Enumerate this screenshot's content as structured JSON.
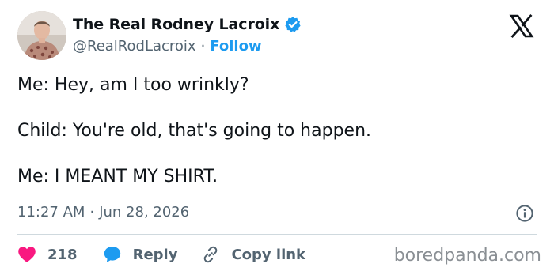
{
  "author": {
    "display_name": "The Real Rodney Lacroix",
    "handle": "@RealRodLacroix",
    "separator": "·",
    "follow_label": "Follow",
    "verified_badge_icon": "verified-badge-icon",
    "avatar_icon": "avatar-photo"
  },
  "brand_icon": "x-logo-icon",
  "tweet": {
    "lines": [
      "Me: Hey, am I too wrinkly?",
      "Child: You're old, that's going to happen.",
      "Me: I MEANT MY SHIRT."
    ]
  },
  "meta": {
    "time": "11:27 AM",
    "separator": "·",
    "date": "Jun 28, 2026",
    "info_icon": "info-icon"
  },
  "actions": {
    "like_count": "218",
    "like_icon": "heart-icon",
    "reply_label": "Reply",
    "reply_icon": "speech-bubble-icon",
    "copy_label": "Copy link",
    "copy_icon": "link-icon"
  },
  "watermark": "boredpanda.com",
  "colors": {
    "text": "#0f1419",
    "secondary": "#536471",
    "accent": "#1d9bf0",
    "like": "#f91880",
    "divider": "#cfd9de"
  }
}
